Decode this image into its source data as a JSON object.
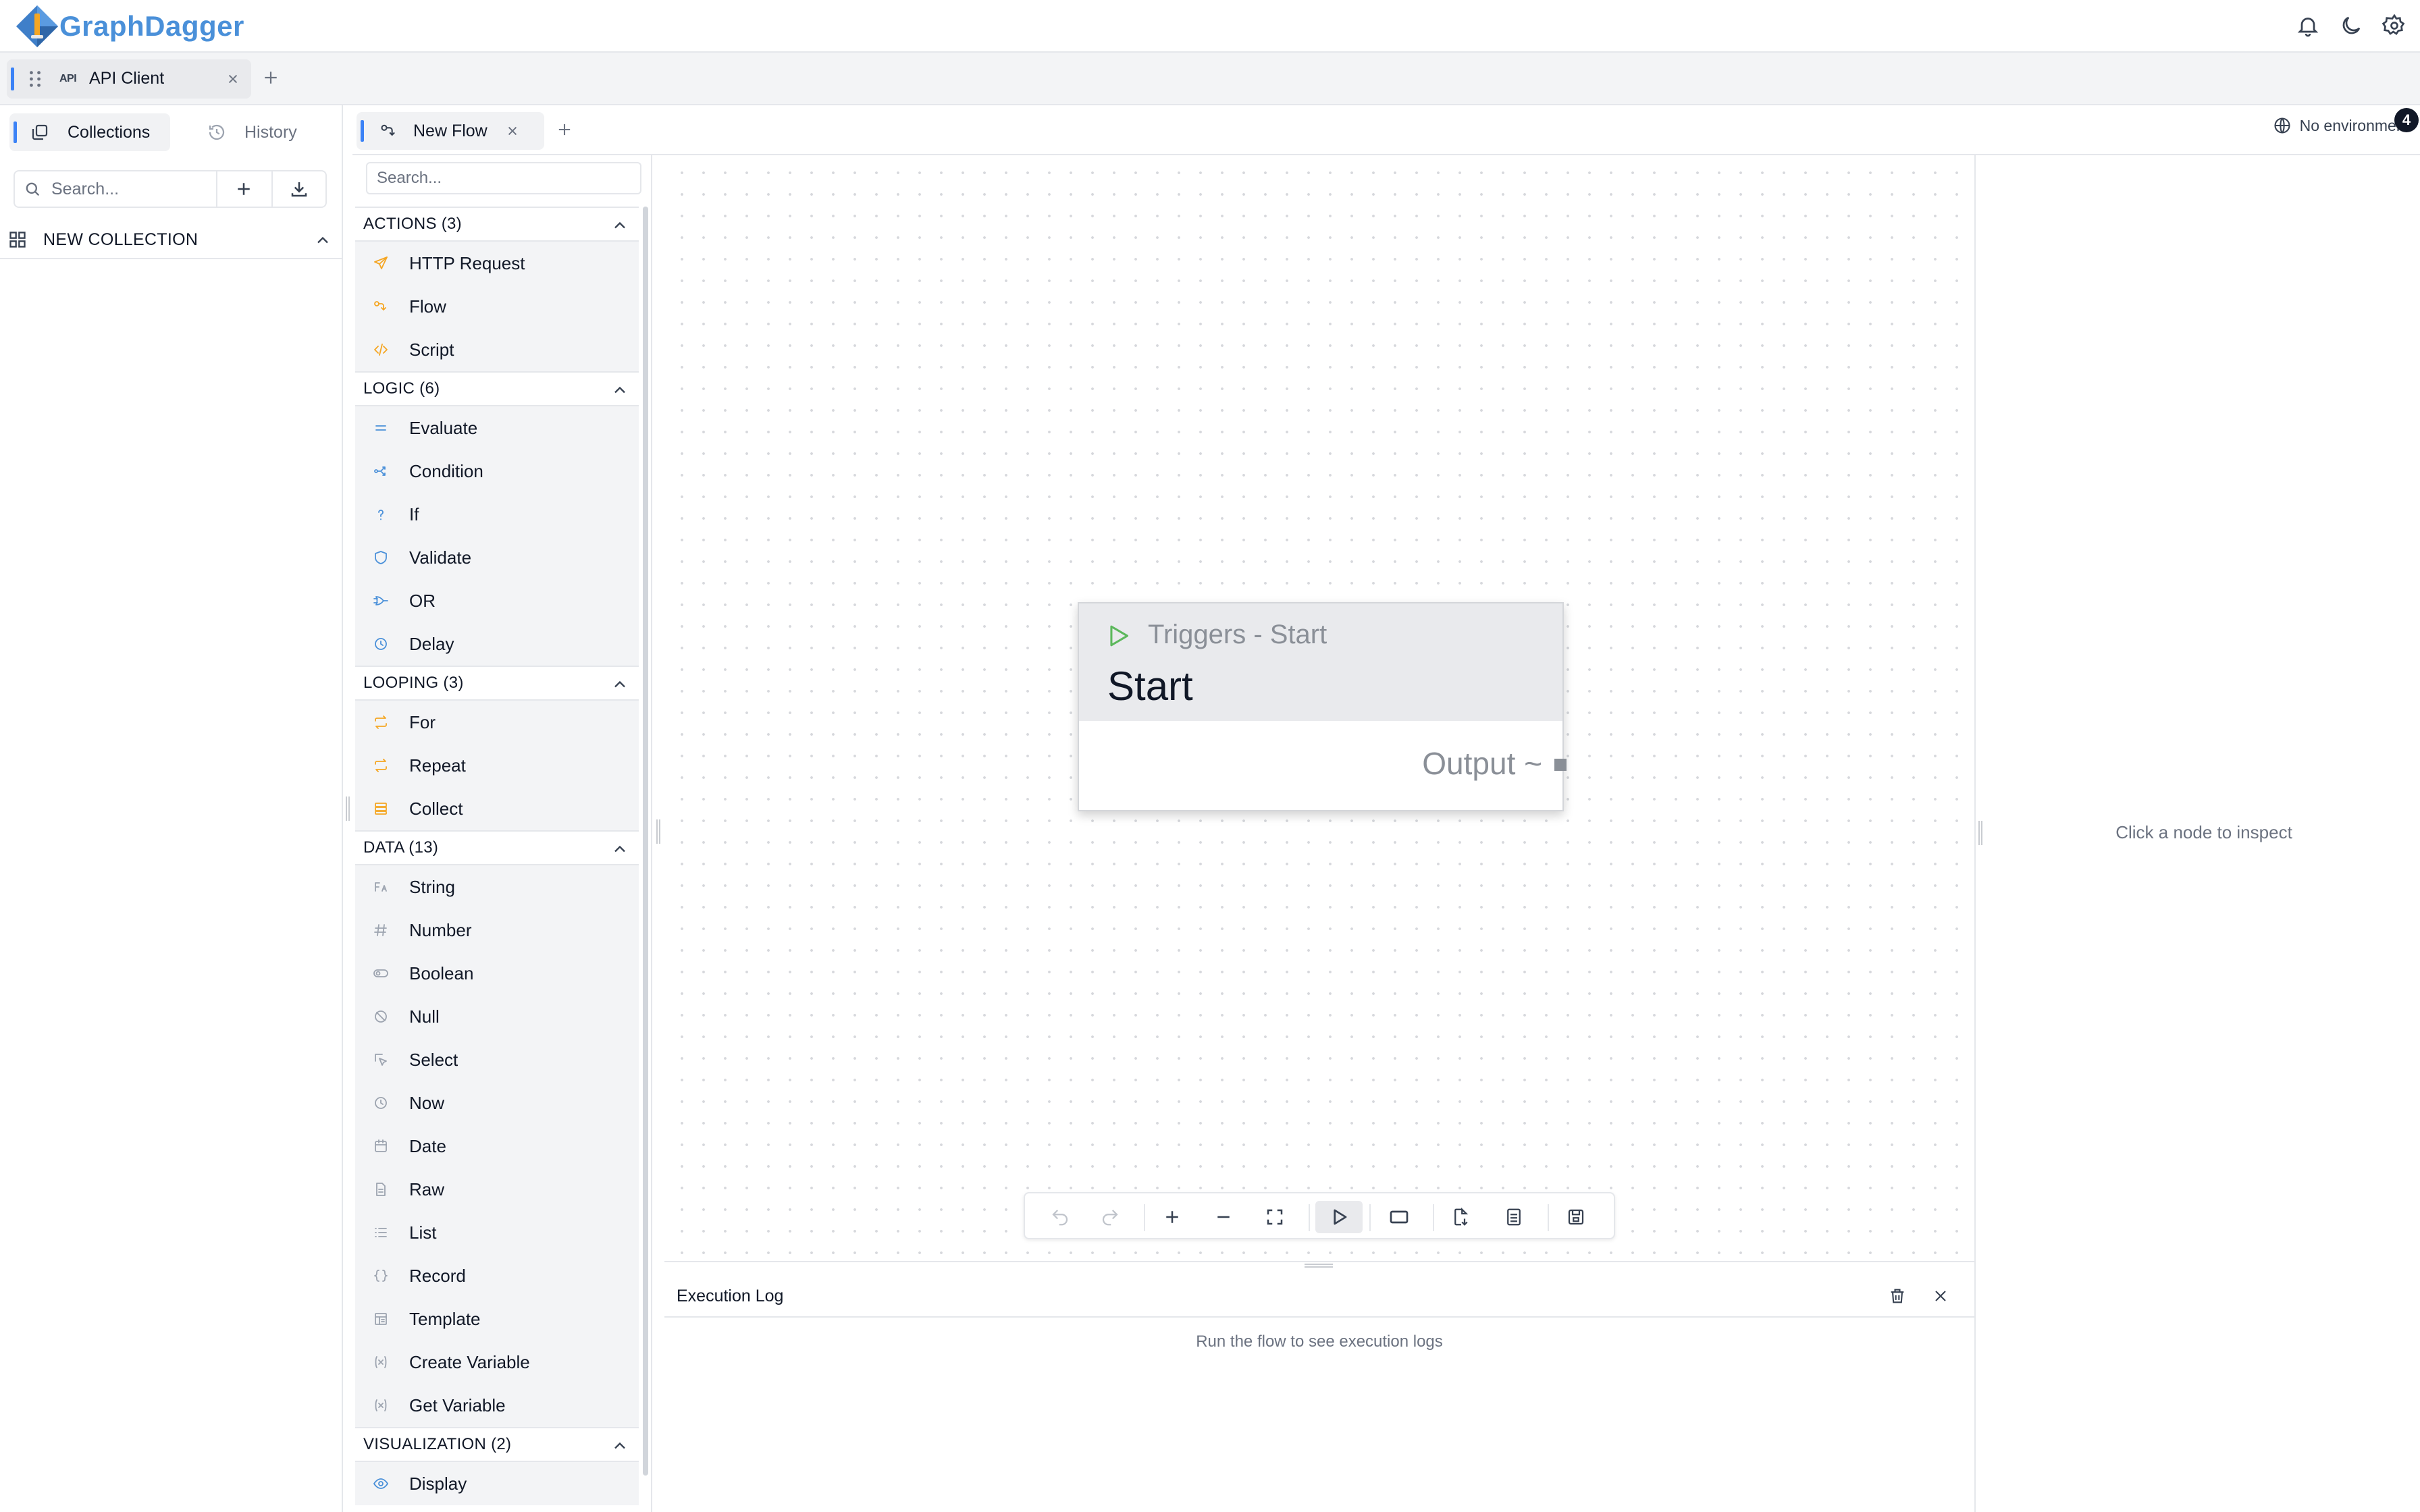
{
  "app": {
    "name": "GraphDagger",
    "brand_color": "#4a90d9",
    "accent_color": "#3b82f6"
  },
  "header": {
    "icons": [
      "bell-icon",
      "moon-icon",
      "gear-icon"
    ]
  },
  "workspace_tab": {
    "badge": "API",
    "label": "API Client"
  },
  "left_sidebar": {
    "tabs": [
      {
        "label": "Collections",
        "icon": "collections-icon",
        "active": true
      },
      {
        "label": "History",
        "icon": "history-icon",
        "active": false
      }
    ],
    "search_placeholder": "Search...",
    "collection": {
      "label": "NEW COLLECTION"
    }
  },
  "flow_tab": {
    "label": "New Flow"
  },
  "environment": {
    "label": "No environment",
    "badge_count": "4"
  },
  "palette": {
    "search_placeholder": "Search...",
    "sections": [
      {
        "label": "ACTIONS (3)",
        "items": [
          {
            "label": "HTTP Request",
            "icon": "send-icon",
            "color": "#f5a623"
          },
          {
            "label": "Flow",
            "icon": "flow-icon",
            "color": "#f5a623"
          },
          {
            "label": "Script",
            "icon": "code-icon",
            "color": "#f5a623"
          }
        ]
      },
      {
        "label": "LOGIC (6)",
        "items": [
          {
            "label": "Evaluate",
            "icon": "equals-icon",
            "color": "#4a90d9"
          },
          {
            "label": "Condition",
            "icon": "branch-icon",
            "color": "#4a90d9"
          },
          {
            "label": "If",
            "icon": "question-icon",
            "color": "#4a90d9"
          },
          {
            "label": "Validate",
            "icon": "shield-icon",
            "color": "#4a90d9"
          },
          {
            "label": "OR",
            "icon": "or-gate-icon",
            "color": "#4a90d9"
          },
          {
            "label": "Delay",
            "icon": "clock-icon",
            "color": "#4a90d9"
          }
        ]
      },
      {
        "label": "LOOPING (3)",
        "items": [
          {
            "label": "For",
            "icon": "repeat-icon",
            "color": "#f5a623"
          },
          {
            "label": "Repeat",
            "icon": "repeat-icon",
            "color": "#f5a623"
          },
          {
            "label": "Collect",
            "icon": "stack-icon",
            "color": "#f5a623"
          }
        ]
      },
      {
        "label": "DATA (13)",
        "items": [
          {
            "label": "String",
            "icon": "text-icon",
            "color": "#9ca3af"
          },
          {
            "label": "Number",
            "icon": "hash-icon",
            "color": "#9ca3af"
          },
          {
            "label": "Boolean",
            "icon": "toggle-icon",
            "color": "#9ca3af"
          },
          {
            "label": "Null",
            "icon": "null-icon",
            "color": "#9ca3af"
          },
          {
            "label": "Select",
            "icon": "cursor-select-icon",
            "color": "#9ca3af"
          },
          {
            "label": "Now",
            "icon": "clock-icon",
            "color": "#9ca3af"
          },
          {
            "label": "Date",
            "icon": "calendar-icon",
            "color": "#9ca3af"
          },
          {
            "label": "Raw",
            "icon": "file-icon",
            "color": "#9ca3af"
          },
          {
            "label": "List",
            "icon": "list-icon",
            "color": "#9ca3af"
          },
          {
            "label": "Record",
            "icon": "braces-icon",
            "color": "#9ca3af"
          },
          {
            "label": "Template",
            "icon": "template-icon",
            "color": "#9ca3af"
          },
          {
            "label": "Create Variable",
            "icon": "variable-icon",
            "color": "#9ca3af"
          },
          {
            "label": "Get Variable",
            "icon": "variable-icon",
            "color": "#9ca3af"
          }
        ]
      },
      {
        "label": "VISUALIZATION (2)",
        "items": [
          {
            "label": "Display",
            "icon": "eye-icon",
            "color": "#4a90d9"
          }
        ]
      }
    ]
  },
  "node": {
    "type_label": "Triggers - Start",
    "title": "Start",
    "output_label": "Output ~",
    "play_color": "#5cb85c"
  },
  "toolbar": {
    "buttons": [
      "undo-icon",
      "redo-icon",
      "zoom-in-icon",
      "zoom-out-icon",
      "fit-view-icon",
      "run-icon",
      "frame-icon",
      "export-icon",
      "notes-icon",
      "save-icon"
    ]
  },
  "execution_log": {
    "title": "Execution Log",
    "empty_message": "Run the flow to see execution logs"
  },
  "inspector": {
    "empty_message": "Click a node to inspect"
  }
}
